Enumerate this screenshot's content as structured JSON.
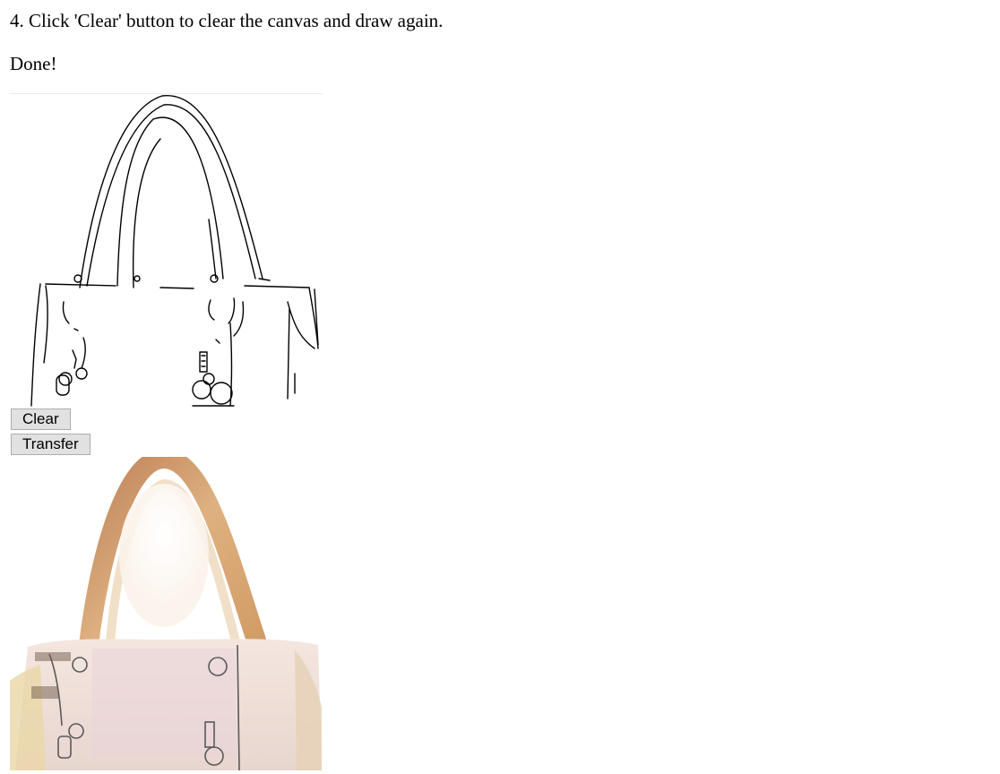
{
  "instructions": {
    "step4": "4. Click 'Clear' button to clear the canvas and draw again."
  },
  "status": {
    "text": "Done!"
  },
  "buttons": {
    "clear_label": "Clear",
    "transfer_label": "Transfer"
  },
  "images": {
    "sketch_canvas": "handbag-edge-sketch",
    "output": "handbag-generated-photo"
  },
  "colors": {
    "button_bg": "#e1e1e1",
    "button_border": "#adadad",
    "text": "#000000"
  }
}
